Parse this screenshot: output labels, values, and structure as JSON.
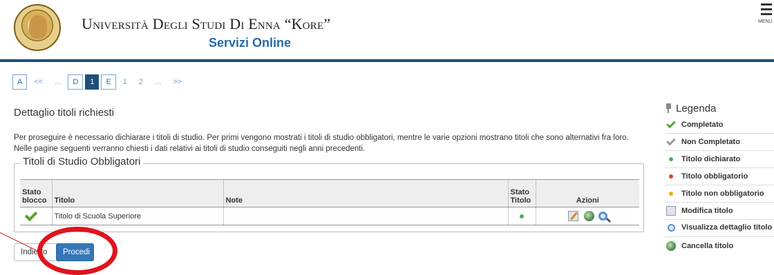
{
  "header": {
    "university": "Università Degli Studi Di Enna “Kore”",
    "subtitle": "Servizi Online",
    "menu_label": "MENU"
  },
  "pager": [
    {
      "label": "A",
      "style": "box"
    },
    {
      "label": "<<",
      "style": "plain"
    },
    {
      "label": "...",
      "style": "plain"
    },
    {
      "label": "D",
      "style": "box"
    },
    {
      "label": "1",
      "style": "active"
    },
    {
      "label": "E",
      "style": "box"
    },
    {
      "label": "1",
      "style": "plain"
    },
    {
      "label": "2",
      "style": "plain"
    },
    {
      "label": "...",
      "style": "plain"
    },
    {
      "label": ">>",
      "style": "plain"
    }
  ],
  "main": {
    "title": "Dettaglio titoli richiesti",
    "intro": "Per proseguire è necessario dichiarare i titoli di studio. Per primi vengono mostrati i titoli di studio obbligatori, mentre le varie opzioni mostrano titoli che sono alternativi fra loro. Nelle pagine seguenti verranno chiesti i dati relativi ai titoli di studio conseguiti negli anni precedenti.",
    "section_title": "Titoli di Studio Obbligatori",
    "table": {
      "headers": {
        "stato_blocco": "Stato blocco",
        "titolo": "Titolo",
        "note": "Note",
        "stato_titolo": "Stato Titolo",
        "azioni": "Azioni"
      },
      "rows": [
        {
          "titolo": "Titolo di Scuola Superiore",
          "note": "",
          "stato_color": "#4caf50"
        }
      ]
    }
  },
  "buttons": {
    "back": "Indietro",
    "next": "Procedi"
  },
  "legenda": {
    "title": "Legenda",
    "items": {
      "completato": "Completato",
      "non_completato": "Non Completato",
      "dichiarato": "Titolo dichiarato",
      "obbligatorio": "Titolo obbligatorio",
      "non_obbligatorio": "Titolo non obbligatorio",
      "modifica": "Modifica titolo",
      "visualizza": "Visualizza dettaglio titolo",
      "cancella": "Cancella titolo"
    },
    "colors": {
      "dichiarato": "#4caf50",
      "obbligatorio": "#e53935",
      "non_obbligatorio": "#f0b400"
    }
  },
  "colors": {
    "brand": "#1f4e79",
    "link": "#2a6aa8",
    "primary_button": "#3477b8",
    "annotation": "#e0141e"
  }
}
